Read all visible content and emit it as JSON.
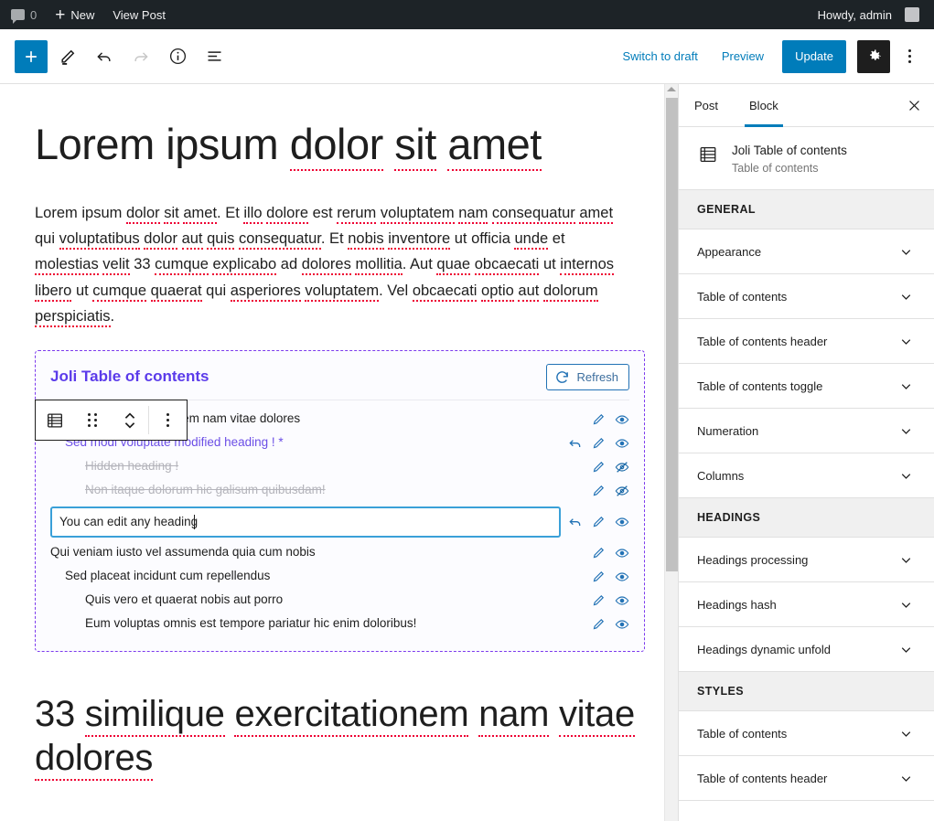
{
  "adminbar": {
    "comment_icon": "comment-bubble-icon",
    "comment_count": "0",
    "new_label": "New",
    "view_post_label": "View Post",
    "howdy": "Howdy, admin"
  },
  "header": {
    "add_block_label": "+",
    "tools": [
      "add-block",
      "edit-pencil",
      "undo",
      "redo",
      "info",
      "list-view"
    ],
    "switch_to_draft": "Switch to draft",
    "preview": "Preview",
    "update": "Update",
    "settings_icon": "gear-icon",
    "more_icon": "kebab-menu-icon"
  },
  "canvas": {
    "title": "Lorem ipsum dolor sit amet",
    "paragraph": "Lorem ipsum dolor sit amet. Et illo dolore est rerum voluptatem nam consequatur amet qui voluptatibus dolor aut quis consequatur. Et nobis inventore ut officia unde et molestias velit 33 cumque explicabo ad dolores mollitia. Aut quae obcaecati ut internos libero ut cumque quaerat qui asperiores voluptatem. Vel obcaecati optio aut dolorum perspiciatis.",
    "heading2": "33 similique exercitationem nam vitae dolores"
  },
  "block_toolbar": {
    "block_type_icon": "table-of-contents-icon",
    "drag_icon": "drag-handle-icon",
    "move_icon": "move-up-down-icon",
    "options_icon": "kebab-menu-icon"
  },
  "toc": {
    "title": "Joli Table of contents",
    "refresh_label": "Refresh",
    "refresh_icon": "refresh-icon",
    "border_color": "#7c3aed",
    "title_color": "#5b3bea",
    "action_color": "#2272b5",
    "rows": [
      {
        "text": "33 similique exercitationem nam vitae dolores",
        "level": 1,
        "state": "normal",
        "actions": [
          "edit-icon",
          "visible-eye-icon"
        ]
      },
      {
        "text": "Sed modi voluptate modified heading ! *",
        "level": 2,
        "state": "modified",
        "actions": [
          "undo-icon",
          "edit-icon",
          "visible-eye-icon"
        ]
      },
      {
        "text": "Hidden heading !",
        "level": 3,
        "state": "hidden",
        "actions": [
          "edit-icon",
          "hidden-eye-icon"
        ]
      },
      {
        "text": "Non itaque dolorum hic galisum quibusdam!",
        "level": 3,
        "state": "hidden",
        "actions": [
          "edit-icon",
          "hidden-eye-icon"
        ]
      },
      {
        "text": "You can edit any heading",
        "level": 1,
        "state": "editing",
        "actions": [
          "undo-icon",
          "edit-icon",
          "visible-eye-icon"
        ]
      },
      {
        "text": "Qui veniam iusto vel assumenda quia cum nobis",
        "level": 1,
        "state": "normal",
        "actions": [
          "edit-icon",
          "visible-eye-icon"
        ]
      },
      {
        "text": "Sed placeat incidunt cum repellendus",
        "level": 2,
        "state": "normal",
        "actions": [
          "edit-icon",
          "visible-eye-icon"
        ]
      },
      {
        "text": "Quis vero et quaerat nobis aut porro",
        "level": 3,
        "state": "normal",
        "actions": [
          "edit-icon",
          "visible-eye-icon"
        ]
      },
      {
        "text": "Eum voluptas omnis est tempore pariatur hic enim doloribus!",
        "level": 3,
        "state": "normal",
        "actions": [
          "edit-icon",
          "visible-eye-icon"
        ]
      }
    ]
  },
  "sidebar": {
    "tabs": [
      {
        "label": "Post",
        "active": false
      },
      {
        "label": "Block",
        "active": true
      }
    ],
    "close_icon": "close-icon",
    "block_card": {
      "icon": "table-of-contents-icon",
      "title": "Joli Table of contents",
      "subtitle": "Table of contents"
    },
    "sections": [
      {
        "title": "GENERAL",
        "panels": [
          "Appearance",
          "Table of contents",
          "Table of contents header",
          "Table of contents toggle",
          "Numeration",
          "Columns"
        ]
      },
      {
        "title": "HEADINGS",
        "panels": [
          "Headings processing",
          "Headings hash",
          "Headings dynamic unfold"
        ]
      },
      {
        "title": "STYLES",
        "panels": [
          "Table of contents",
          "Table of contents header"
        ]
      }
    ]
  }
}
